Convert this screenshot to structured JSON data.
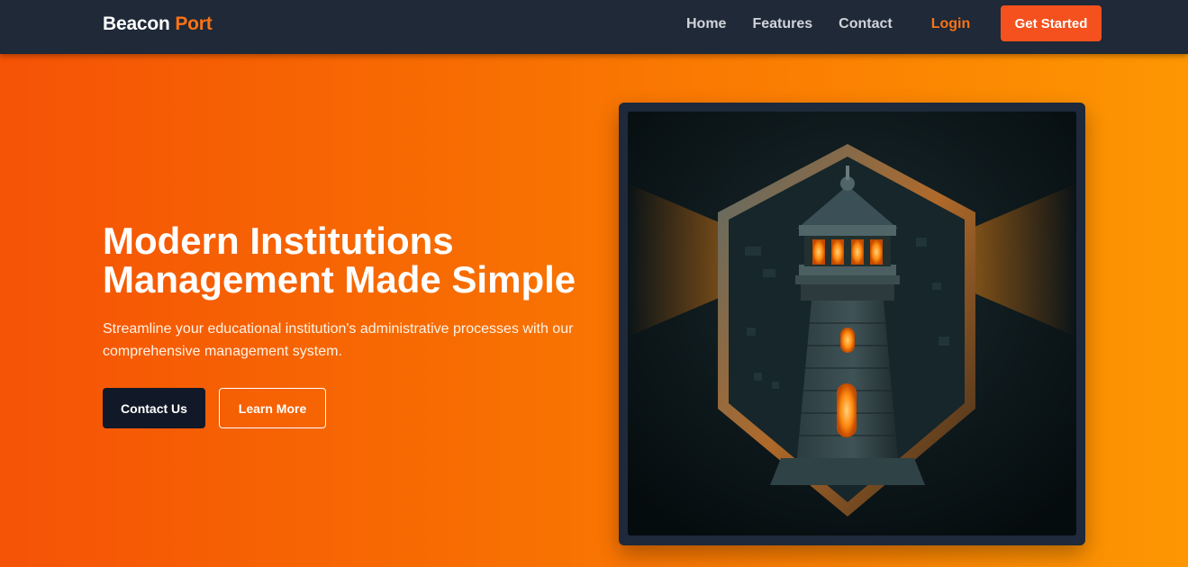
{
  "brand": {
    "name": "Beacon",
    "accent": "Port",
    "accent_color": "#f97316"
  },
  "nav": {
    "links": [
      "Home",
      "Features",
      "Contact"
    ],
    "login": "Login",
    "cta": "Get Started"
  },
  "hero": {
    "headline_line1": "Modern Institutions",
    "headline_line2": "Management Made Simple",
    "subtext": "Streamline your educational institution's administrative processes with our comprehensive management system.",
    "primary_button": "Contact Us",
    "secondary_button": "Learn More",
    "gradient_start": "#f55306",
    "gradient_end": "#fd9602",
    "image_icon": "lighthouse-shield-icon"
  }
}
